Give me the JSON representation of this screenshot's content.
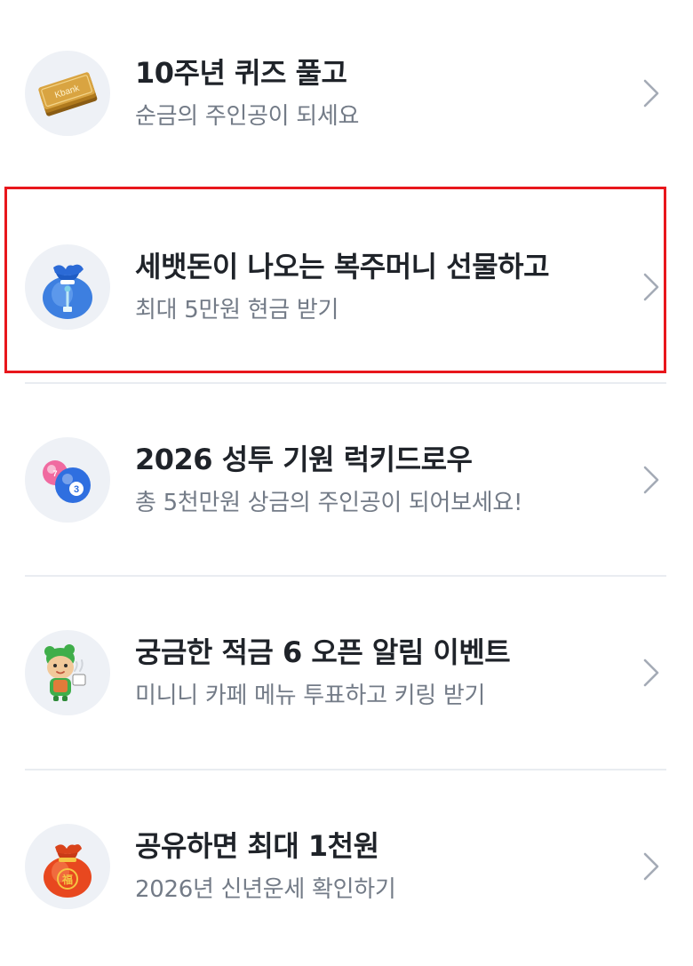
{
  "events": [
    {
      "title": "10주년 퀴즈 풀고",
      "subtitle": "순금의 주인공이 되세요",
      "icon": "gold-ticket-icon"
    },
    {
      "title": "세뱃돈이 나오는 복주머니 선물하고",
      "subtitle": "최대 5만원 현금 받기",
      "icon": "lucky-pouch-icon"
    },
    {
      "title": "2026 성투 기원 럭키드로우",
      "subtitle": "총 5천만원 상금의 주인공이 되어보세요!",
      "icon": "lottery-balls-icon"
    },
    {
      "title": "궁금한 적금 6 오픈 알림 이벤트",
      "subtitle": "미니니 카페 메뉴 투표하고 키링 받기",
      "icon": "minini-character-icon"
    },
    {
      "title": "공유하면 최대 1천원",
      "subtitle": "2026년 신년운세 확인하기",
      "icon": "fortune-bag-icon"
    }
  ],
  "colors": {
    "highlight_border": "#e8161c",
    "title": "#1f2329",
    "subtitle": "#737b87",
    "divider": "#e9ecf1",
    "avatar_bg": "#eef1f6"
  }
}
